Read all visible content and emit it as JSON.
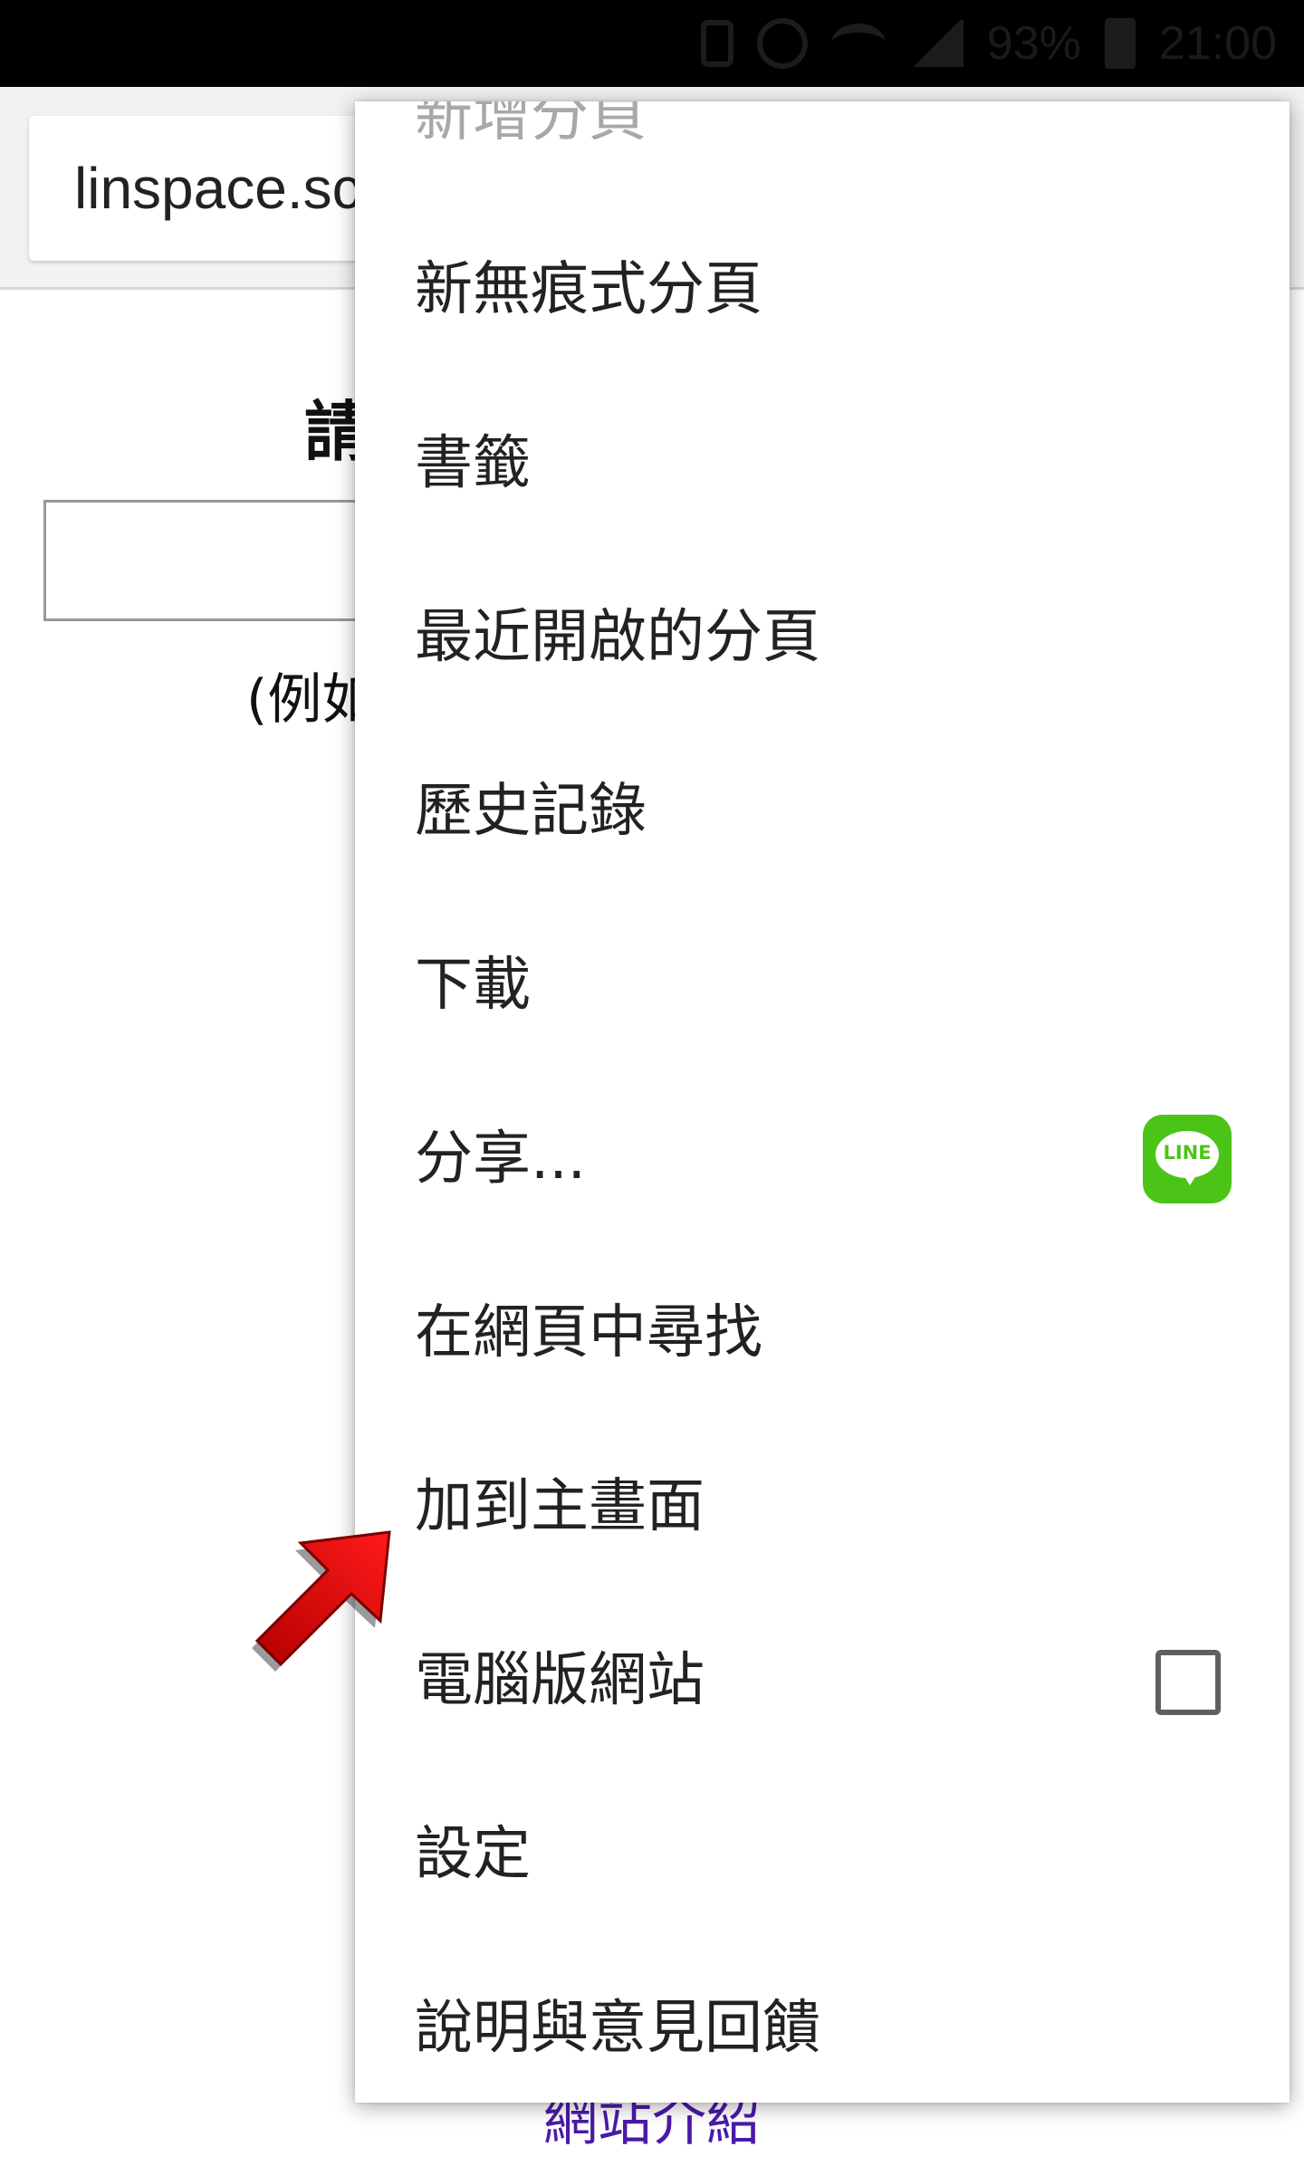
{
  "status_bar": {
    "battery_percent": "93%",
    "time": "21:00",
    "icons": [
      "vibrate-icon",
      "alarm-icon",
      "wifi-icon",
      "signal-icon",
      "battery-icon"
    ]
  },
  "browser": {
    "url": "linspace.sc"
  },
  "page": {
    "heading_partial": "請",
    "example_partial": "(例如",
    "footer_link_partial": "網站介紹"
  },
  "menu": {
    "items": [
      {
        "label": "新增分頁"
      },
      {
        "label": "新無痕式分頁"
      },
      {
        "label": "書籤"
      },
      {
        "label": "最近開啟的分頁"
      },
      {
        "label": "歷史記錄"
      },
      {
        "label": "下載"
      },
      {
        "label": "分享...",
        "icon": "line-app-icon",
        "icon_text": "LINE"
      },
      {
        "label": "在網頁中尋找"
      },
      {
        "label": "加到主畫面"
      },
      {
        "label": "電腦版網站",
        "checkbox_checked": false
      },
      {
        "label": "設定"
      },
      {
        "label": "說明與意見回饋"
      }
    ]
  },
  "colors": {
    "line_green": "#4cc417",
    "arrow_red": "#e60000",
    "link_purple": "#4a1aa8"
  }
}
